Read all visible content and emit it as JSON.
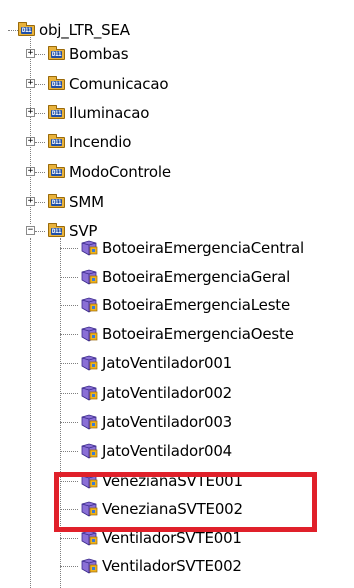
{
  "tree": {
    "root": {
      "label": "obj_LTR_SEA",
      "icon": "folder-icon"
    },
    "folders": [
      {
        "label": "Bombas",
        "expander": "+"
      },
      {
        "label": "Comunicacao",
        "expander": "+"
      },
      {
        "label": "Iluminacao",
        "expander": "+"
      },
      {
        "label": "Incendio",
        "expander": "+"
      },
      {
        "label": "ModoControle",
        "expander": "+"
      },
      {
        "label": "SMM",
        "expander": "+"
      },
      {
        "label": "SVP",
        "expander": "−"
      }
    ],
    "svp_children": [
      "BotoeiraEmergenciaCentral",
      "BotoeiraEmergenciaGeral",
      "BotoeiraEmergenciaLeste",
      "BotoeiraEmergenciaOeste",
      "JatoVentilador001",
      "JatoVentilador002",
      "JatoVentilador003",
      "JatoVentilador004",
      "VenezianaSVTE001",
      "VenezianaSVTE002",
      "VentiladorSVTE001",
      "VentiladorSVTE002"
    ],
    "folder_badge": "D11"
  },
  "colors": {
    "highlight": "#e0202a",
    "folder": "#e8b23c",
    "folder_badge": "#1f4fa8"
  }
}
